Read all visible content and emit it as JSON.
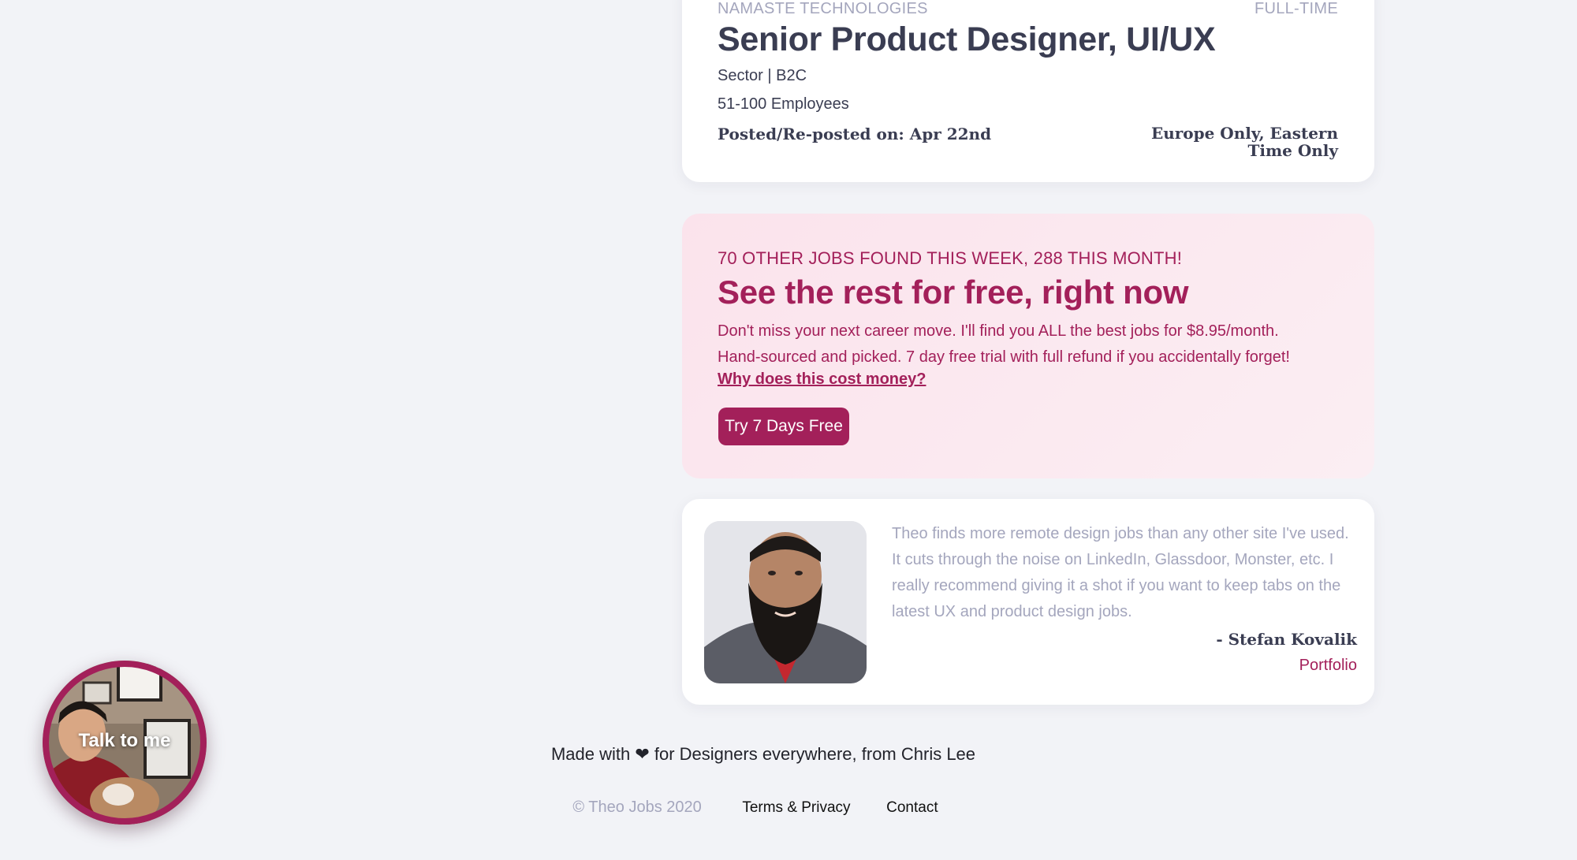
{
  "job": {
    "company": "NAMASTE TECHNOLOGIES",
    "type": "FULL-TIME",
    "title": "Senior Product Designer, UI/UX",
    "sector": "Sector | B2C",
    "employees": "51-100 Employees",
    "posted": "Posted/Re-posted on: Apr 22nd",
    "region": "Europe Only, Eastern Time Only"
  },
  "promo": {
    "kicker": "70 OTHER JOBS FOUND THIS WEEK, 288 THIS MONTH!",
    "title": "See the rest for free, right now",
    "line1": "Don't miss your next career move. I'll find you ALL the best jobs for $8.95/month.",
    "line2": "Hand-sourced and picked. 7 day free trial with full refund if you accidentally forget!",
    "link": "Why does this cost money?",
    "button": "Try 7 Days Free"
  },
  "testimonial": {
    "quote": "Theo finds more remote design jobs than any other site I've used. It cuts through the noise on LinkedIn, Glassdoor, Monster, etc. I really recommend giving it a shot if you want to keep tabs on the latest UX and product design jobs.",
    "author": "- Stefan Kovalik",
    "link": "Portfolio"
  },
  "footer": {
    "made_with": "Made with ❤ for Designers everywhere, from Chris Lee",
    "copyright": "© Theo Jobs 2020",
    "terms": "Terms & Privacy",
    "contact": "Contact"
  },
  "chat": {
    "label": "Talk to me"
  },
  "colors": {
    "accent": "#a3205a",
    "promo_bg": "#fbe3ec",
    "muted_text": "#a4a6bd",
    "dark_text": "#3a3d52",
    "page_bg": "#f2f3f7"
  }
}
